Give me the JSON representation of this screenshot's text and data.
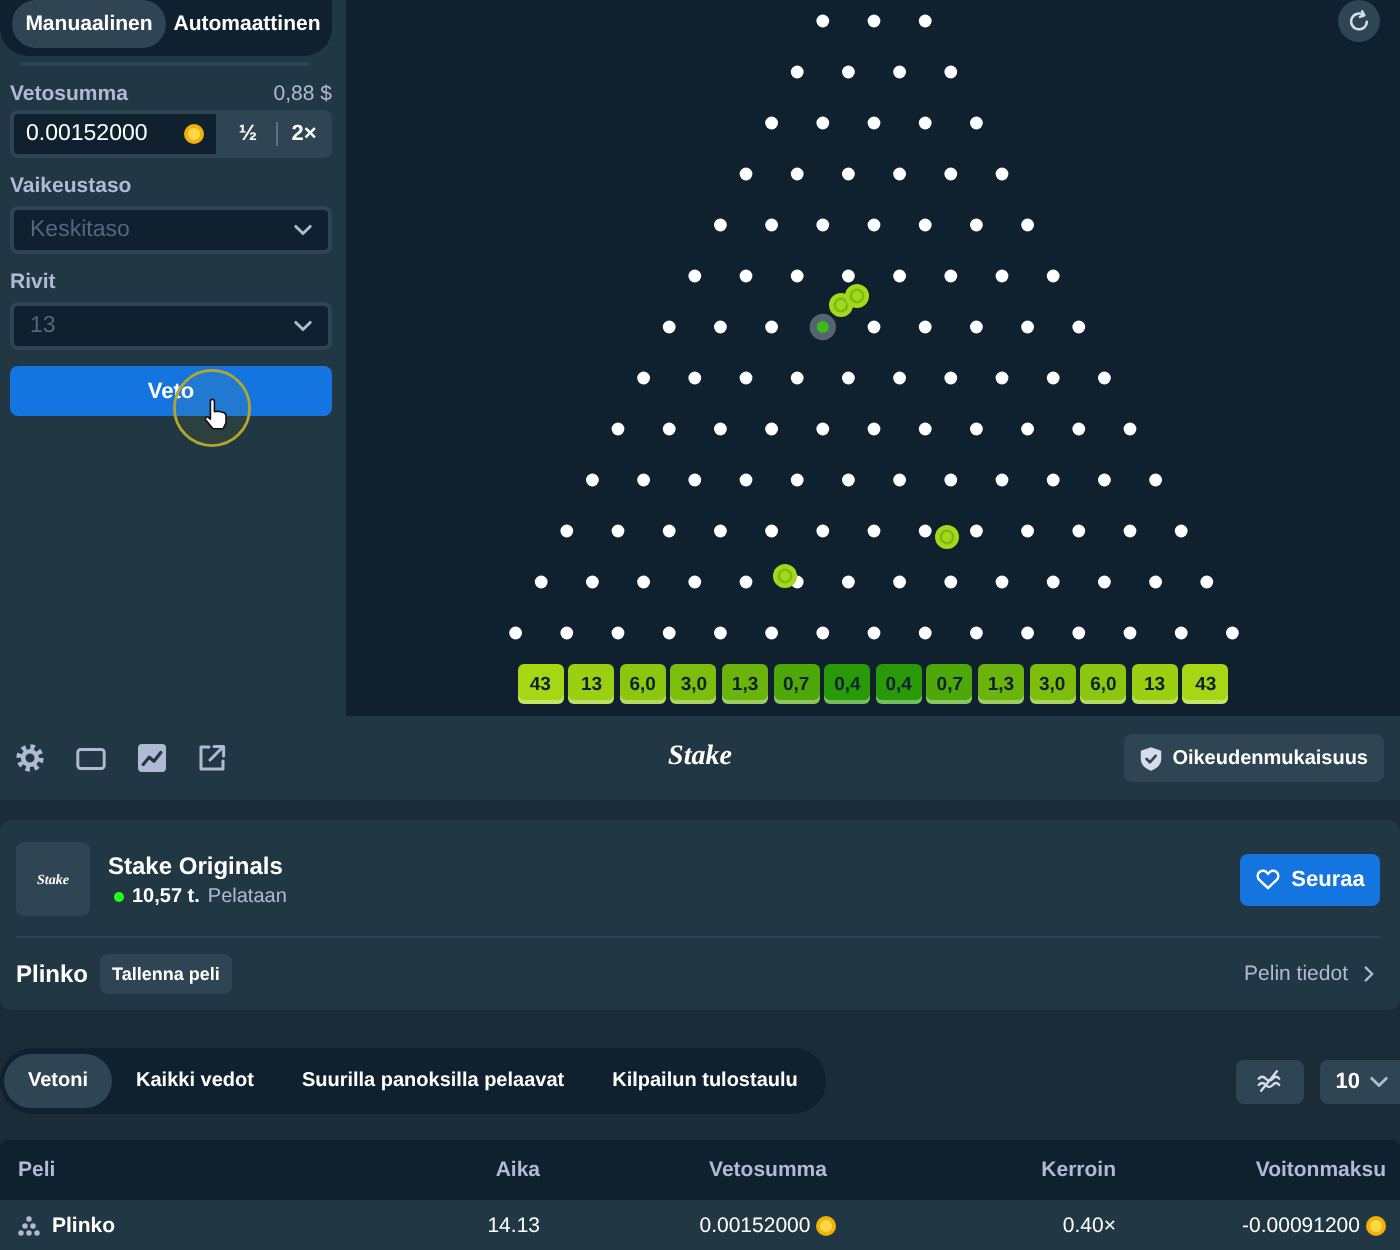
{
  "sidebar": {
    "mode_tabs": [
      {
        "label": "Manuaalinen",
        "selected": true
      },
      {
        "label": "Automaattinen",
        "selected": false
      }
    ],
    "bet_amount": {
      "label": "Vetosumma",
      "converted": "0,88 $",
      "value": "0.00152000",
      "buttons": [
        "½",
        "2×"
      ]
    },
    "risk": {
      "label": "Vaikeustaso",
      "value": "Keskitaso",
      "disabled": true
    },
    "rows": {
      "label": "Rivit",
      "value": "13",
      "disabled": true
    },
    "bet_button": "Veto"
  },
  "board": {
    "multipliers": [
      {
        "label": "43",
        "color": "#a6d614"
      },
      {
        "label": "13",
        "color": "#9bd012"
      },
      {
        "label": "6,0",
        "color": "#8cc70f"
      },
      {
        "label": "3,0",
        "color": "#7dbe0d"
      },
      {
        "label": "1,3",
        "color": "#6bb40b"
      },
      {
        "label": "0,7",
        "color": "#4ea809"
      },
      {
        "label": "0,4",
        "color": "#289a08"
      },
      {
        "label": "0,4",
        "color": "#289a08"
      },
      {
        "label": "0,7",
        "color": "#4ea809"
      },
      {
        "label": "1,3",
        "color": "#6bb40b"
      },
      {
        "label": "3,0",
        "color": "#7dbe0d"
      },
      {
        "label": "6,0",
        "color": "#8cc70f"
      },
      {
        "label": "13",
        "color": "#9bd012"
      },
      {
        "label": "43",
        "color": "#a6d614"
      }
    ]
  },
  "toolbar": {
    "logo": "Stake",
    "fairness_button": "Oikeudenmukaisuus"
  },
  "game_card": {
    "logo": "Stake",
    "title": "Stake Originals",
    "players": "10,57 t.",
    "players_label": "Pelataan",
    "follow_button": "Seuraa",
    "game_name": "Plinko",
    "save_button": "Tallenna peli",
    "info_link": "Pelin tiedot"
  },
  "bet_tabs": [
    {
      "label": "Vetoni",
      "selected": true
    },
    {
      "label": "Kaikki vedot",
      "selected": false
    },
    {
      "label": "Suurilla panoksilla pelaavat",
      "selected": false
    },
    {
      "label": "Kilpailun tulostaulu",
      "selected": false
    }
  ],
  "page_size": "10",
  "table": {
    "columns": [
      "Peli",
      "Aika",
      "Vetosumma",
      "Kerroin",
      "Voitonmaksu"
    ],
    "rows": [
      {
        "game": "Plinko",
        "time": "14.13",
        "bet": "0.00152000",
        "multiplier": "0.40×",
        "payout": "-0.00091200"
      }
    ]
  }
}
